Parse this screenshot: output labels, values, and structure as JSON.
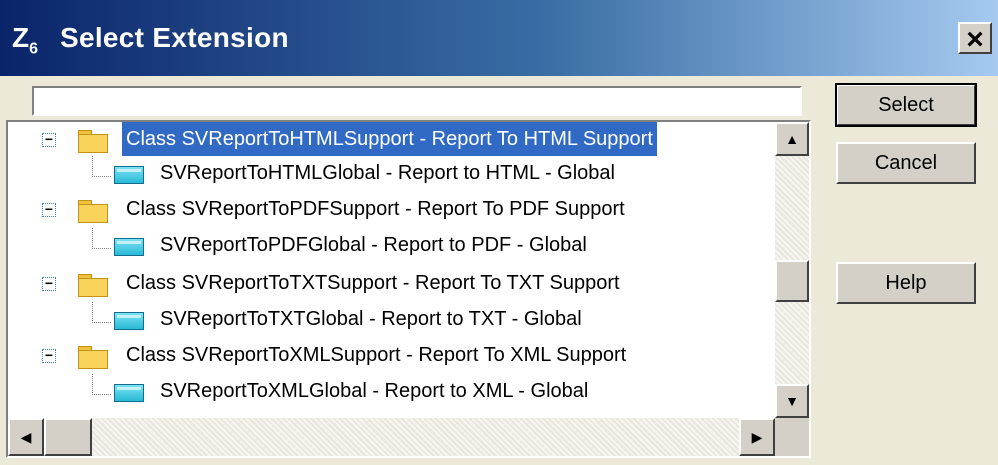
{
  "window": {
    "title": "Select Extension",
    "app_icon": "z6-app-icon",
    "close_label": "×"
  },
  "search": {
    "value": ""
  },
  "buttons": {
    "select": "Select",
    "cancel": "Cancel",
    "help": "Help"
  },
  "tree": {
    "items": [
      {
        "type": "class",
        "label": "Class SVReportToHTMLSupport - Report To HTML Support",
        "selected": true,
        "expander": "−"
      },
      {
        "type": "global",
        "label": "SVReportToHTMLGlobal - Report to HTML - Global"
      },
      {
        "type": "class",
        "label": "Class SVReportToPDFSupport - Report To PDF Support",
        "expander": "−"
      },
      {
        "type": "global",
        "label": "SVReportToPDFGlobal - Report to PDF - Global"
      },
      {
        "type": "class",
        "label": "Class SVReportToTXTSupport - Report To TXT Support",
        "expander": "−"
      },
      {
        "type": "global",
        "label": "SVReportToTXTGlobal - Report to TXT - Global"
      },
      {
        "type": "class",
        "label": "Class SVReportToXMLSupport - Report To XML Support",
        "expander": "−"
      },
      {
        "type": "global",
        "label": "SVReportToXMLGlobal - Report to XML - Global"
      }
    ]
  },
  "scrollbars": {
    "up_arrow": "▲",
    "down_arrow": "▼",
    "left_arrow": "◀",
    "right_arrow": "▶"
  },
  "colors": {
    "selection": "#316ac5",
    "title_start": "#0a246a",
    "title_end": "#a6caf0"
  }
}
